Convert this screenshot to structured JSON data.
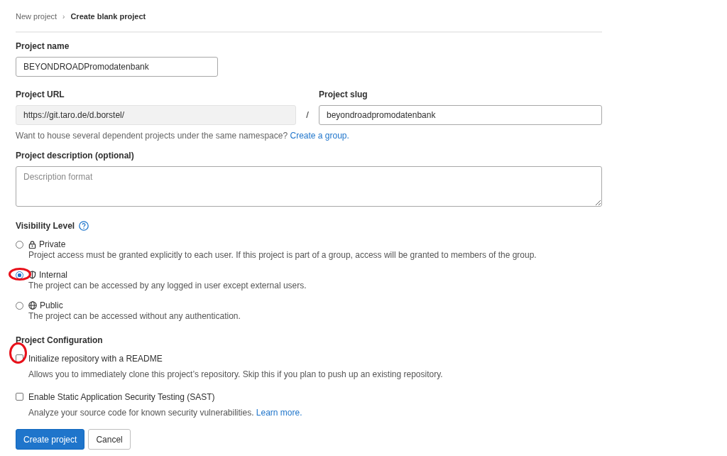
{
  "breadcrumb": [
    {
      "label": "New project",
      "current": false
    },
    {
      "label": "Create blank project",
      "current": true
    }
  ],
  "separator": "›",
  "project_name": {
    "label": "Project name",
    "value": "BEYONDROADPromodatenbank"
  },
  "project_url": {
    "label": "Project URL",
    "value": "https://git.taro.de/d.borstel/"
  },
  "slash": "/",
  "project_slug": {
    "label": "Project slug",
    "value": "beyondroadpromodatenbank"
  },
  "namespace_help": {
    "text": "Want to house several dependent projects under the same namespace?",
    "link": "Create a group."
  },
  "description": {
    "label": "Project description (optional)",
    "placeholder": "Description format"
  },
  "visibility": {
    "label": "Visibility Level",
    "options": [
      {
        "kind": "lock",
        "label": "Private",
        "help": "Project access must be granted explicitly to each user. If this project is part of a group, access will be granted to members of the group.",
        "selected": false
      },
      {
        "kind": "shield",
        "label": "Internal",
        "help": "The project can be accessed by any logged in user except external users.",
        "selected": true
      },
      {
        "kind": "globe",
        "label": "Public",
        "help": "The project can be accessed without any authentication.",
        "selected": false
      }
    ]
  },
  "configuration": {
    "label": "Project Configuration",
    "options": [
      {
        "label": "Initialize repository with a README",
        "help": "Allows you to immediately clone this project’s repository. Skip this if you plan to push up an existing repository.",
        "checked": false
      },
      {
        "label": "Enable Static Application Security Testing (SAST)",
        "help": "Analyze your source code for known security vulnerabilities.",
        "link": "Learn more.",
        "checked": false
      }
    ]
  },
  "buttons": [
    {
      "kind": "primary",
      "label": "Create project"
    },
    {
      "kind": "secondary",
      "label": "Cancel"
    }
  ]
}
